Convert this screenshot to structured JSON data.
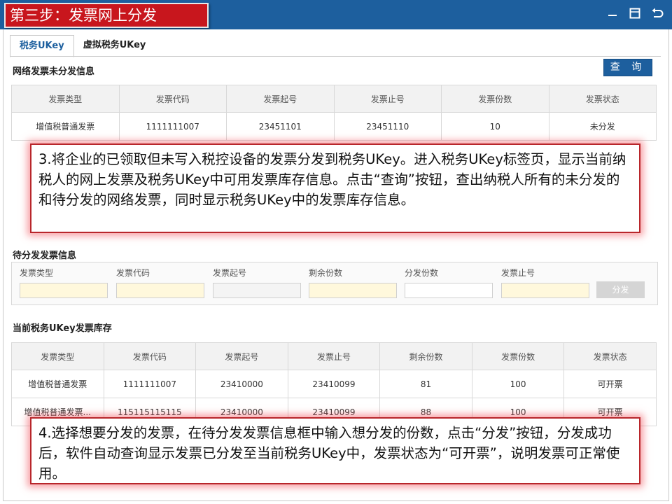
{
  "header": {
    "step_title": "第三步：发票网上分发"
  },
  "tabs": [
    {
      "label": "税务UKey",
      "active": true
    },
    {
      "label": "虚拟税务UKey",
      "active": false
    }
  ],
  "network_section": {
    "title": "网络发票未分发信息",
    "query_button": "查 询",
    "columns": [
      "发票类型",
      "发票代码",
      "发票起号",
      "发票止号",
      "发票份数",
      "发票状态"
    ],
    "rows": [
      [
        "增值税普通发票",
        "1111111007",
        "23451101",
        "23451110",
        "10",
        "未分发"
      ]
    ]
  },
  "callout_1": {
    "text": "3.将企业的已领取但未写入税控设备的发票分发到税务UKey。进入税务UKey标签页，显示当前纳税人的网上发票及税务UKey中可用发票库存信息。点击“查询”按钮，查出纳税人所有的未分发的和待分发的网络发票，同时显示税务UKey中的发票库存信息。"
  },
  "pending_section": {
    "title": "待分发发票信息",
    "fields": [
      {
        "label": "发票类型"
      },
      {
        "label": "发票代码"
      },
      {
        "label": "发票起号"
      },
      {
        "label": "剩余份数"
      },
      {
        "label": "分发份数"
      },
      {
        "label": "发票止号"
      }
    ],
    "distribute_button": "分发"
  },
  "inventory_section": {
    "title": "当前税务UKey发票库存",
    "columns": [
      "发票类型",
      "发票代码",
      "发票起号",
      "发票止号",
      "剩余份数",
      "发票份数",
      "发票状态"
    ],
    "rows": [
      [
        "增值税普通发票",
        "1111111007",
        "23410000",
        "23410099",
        "81",
        "100",
        "可开票"
      ],
      [
        "增值税普通发票...",
        "115115115115",
        "23410000",
        "23410099",
        "88",
        "100",
        "可开票"
      ]
    ]
  },
  "callout_2": {
    "text": "4.选择想要分发的发票，在待分发发票信息框中输入想分发的份数，点击“分发”按钮，分发成功后，软件自动查询显示发票已分发至当前税务UKey中，发票状态为“可开票”，说明发票可正常使用。"
  },
  "colors": {
    "header_blue": "#1d5f9e",
    "step_red": "#c8161d",
    "highlight_input": "#fff8dc"
  }
}
